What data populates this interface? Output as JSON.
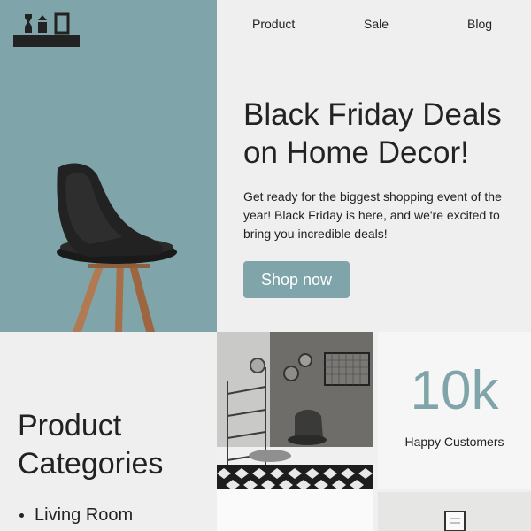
{
  "nav": {
    "items": [
      "Product",
      "Sale",
      "Blog"
    ]
  },
  "hero": {
    "headline": "Black Friday Deals on Home Decor!",
    "subtext": "Get ready for the biggest shopping event of the year! Black Friday is here, and we're excited to bring you incredible deals!",
    "cta_label": "Shop now"
  },
  "categories": {
    "title": "Product Categories",
    "items": [
      "Living Room"
    ]
  },
  "stats": {
    "value": "10k",
    "label": "Happy Customers"
  },
  "colors": {
    "accent": "#7fa5aa",
    "text": "#222222",
    "background": "#efefef"
  }
}
